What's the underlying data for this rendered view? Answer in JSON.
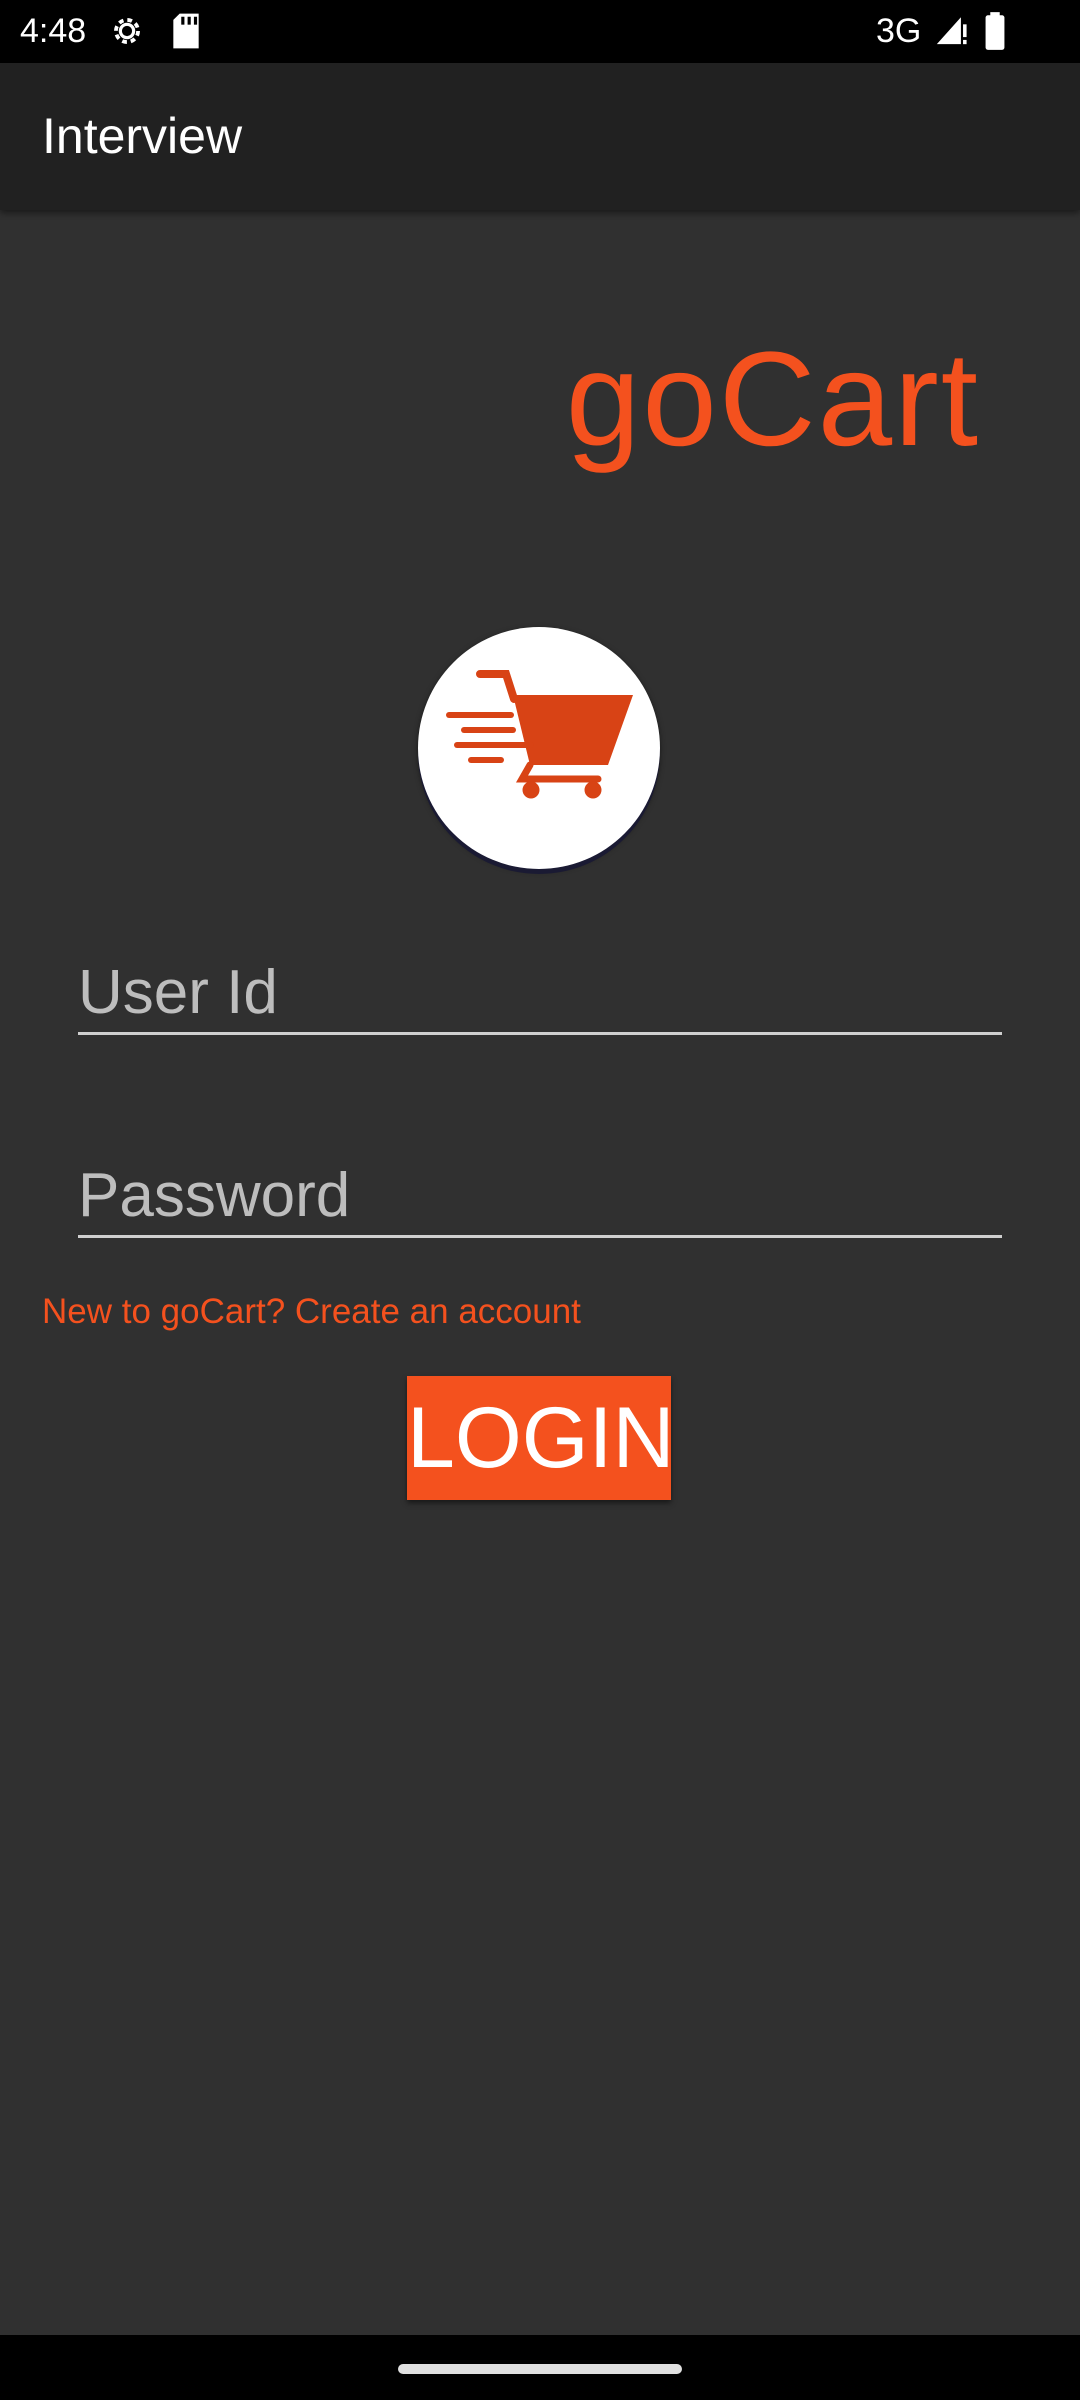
{
  "status_bar": {
    "time": "4:48",
    "network": "3G",
    "icons": [
      "settings-icon",
      "sd-card-icon",
      "signal-icon",
      "battery-icon"
    ]
  },
  "app_bar": {
    "title": "Interview"
  },
  "brand": {
    "title": "goCart",
    "logo": "shopping-cart-icon",
    "accent_color": "#f4511e"
  },
  "form": {
    "user_id_placeholder": "User Id",
    "user_id_value": "",
    "password_placeholder": "Password",
    "password_value": "",
    "signup_link": "New to goCart? Create an account",
    "login_label": "LOGIN"
  },
  "theme": {
    "background": "#303030",
    "app_bar_color": "#212121"
  }
}
